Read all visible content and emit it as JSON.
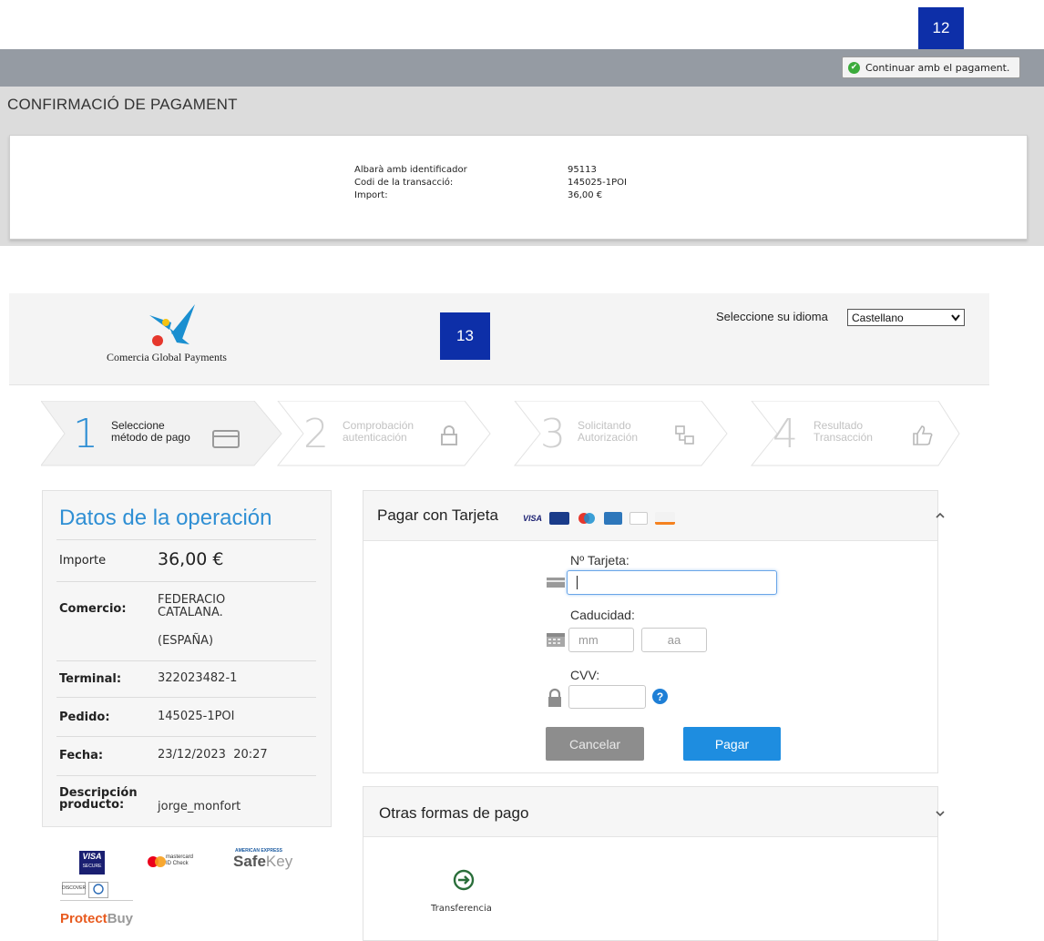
{
  "annotations": {
    "badge_top": "12",
    "badge_mid": "13"
  },
  "erp": {
    "continue_button": "Continuar amb el pagament.",
    "title": "CONFIRMACIÓ DE PAGAMENT",
    "fields": [
      {
        "label": "Albarà amb identificador",
        "value": "95113"
      },
      {
        "label": "Codi de la transacció:",
        "value": "145025-1POI"
      },
      {
        "label": "Import:",
        "value": "36,00 €"
      }
    ]
  },
  "gateway": {
    "logo_text": "Comercia Global Payments",
    "language_label": "Seleccione su idioma",
    "language_selected": "Castellano",
    "steps": [
      {
        "number": "1",
        "line1": "Seleccione",
        "line2": "método de pago",
        "active": true
      },
      {
        "number": "2",
        "line1": "Comprobación",
        "line2": "autenticación",
        "active": false
      },
      {
        "number": "3",
        "line1": "Solicitando",
        "line2": "Autorización",
        "active": false
      },
      {
        "number": "4",
        "line1": "Resultado",
        "line2": "Transacción",
        "active": false
      }
    ],
    "operation": {
      "title": "Datos de la operación",
      "importe_label": "Importe",
      "importe_value": "36,00 €",
      "comercio_label": "Comercio:",
      "comercio_line1": "FEDERACIO",
      "comercio_line2": "CATALANA.",
      "comercio_line3": "(ESPAÑA)",
      "terminal_label": "Terminal:",
      "terminal_value": "322023482-1",
      "pedido_label": "Pedido:",
      "pedido_value": "145025-1POI",
      "fecha_label": "Fecha:",
      "fecha_value": "23/12/2023  20:27",
      "descripcion_label_1": "Descripción",
      "descripcion_label_2": "producto:",
      "descripcion_value": "jorge_monfort"
    },
    "security_logos": {
      "visa": "VISA",
      "visa_secure": "SECURE",
      "mastercard_line1": "mastercard",
      "mastercard_line2": "ID Check",
      "amex_top": "AMERICAN EXPRESS",
      "safekey_1": "Safe",
      "safekey_2": "Key",
      "discover": "DISCOVER",
      "protectbuy_1": "Protect",
      "protectbuy_2": "Buy"
    },
    "card_payment": {
      "title": "Pagar con Tarjeta",
      "card_number_label": "Nº Tarjeta:",
      "card_number_value": "",
      "expiry_label": "Caducidad:",
      "month_placeholder": "mm",
      "year_placeholder": "aa",
      "cvv_label": "CVV:",
      "cancel_label": "Cancelar",
      "pay_label": "Pagar"
    },
    "other_payments": {
      "title": "Otras formas de pago",
      "transfer_label": "Transferencia"
    }
  },
  "colors": {
    "accent_blue": "#2f8fd4",
    "pay_button": "#1e8de0",
    "badge": "#0d2fa8"
  }
}
